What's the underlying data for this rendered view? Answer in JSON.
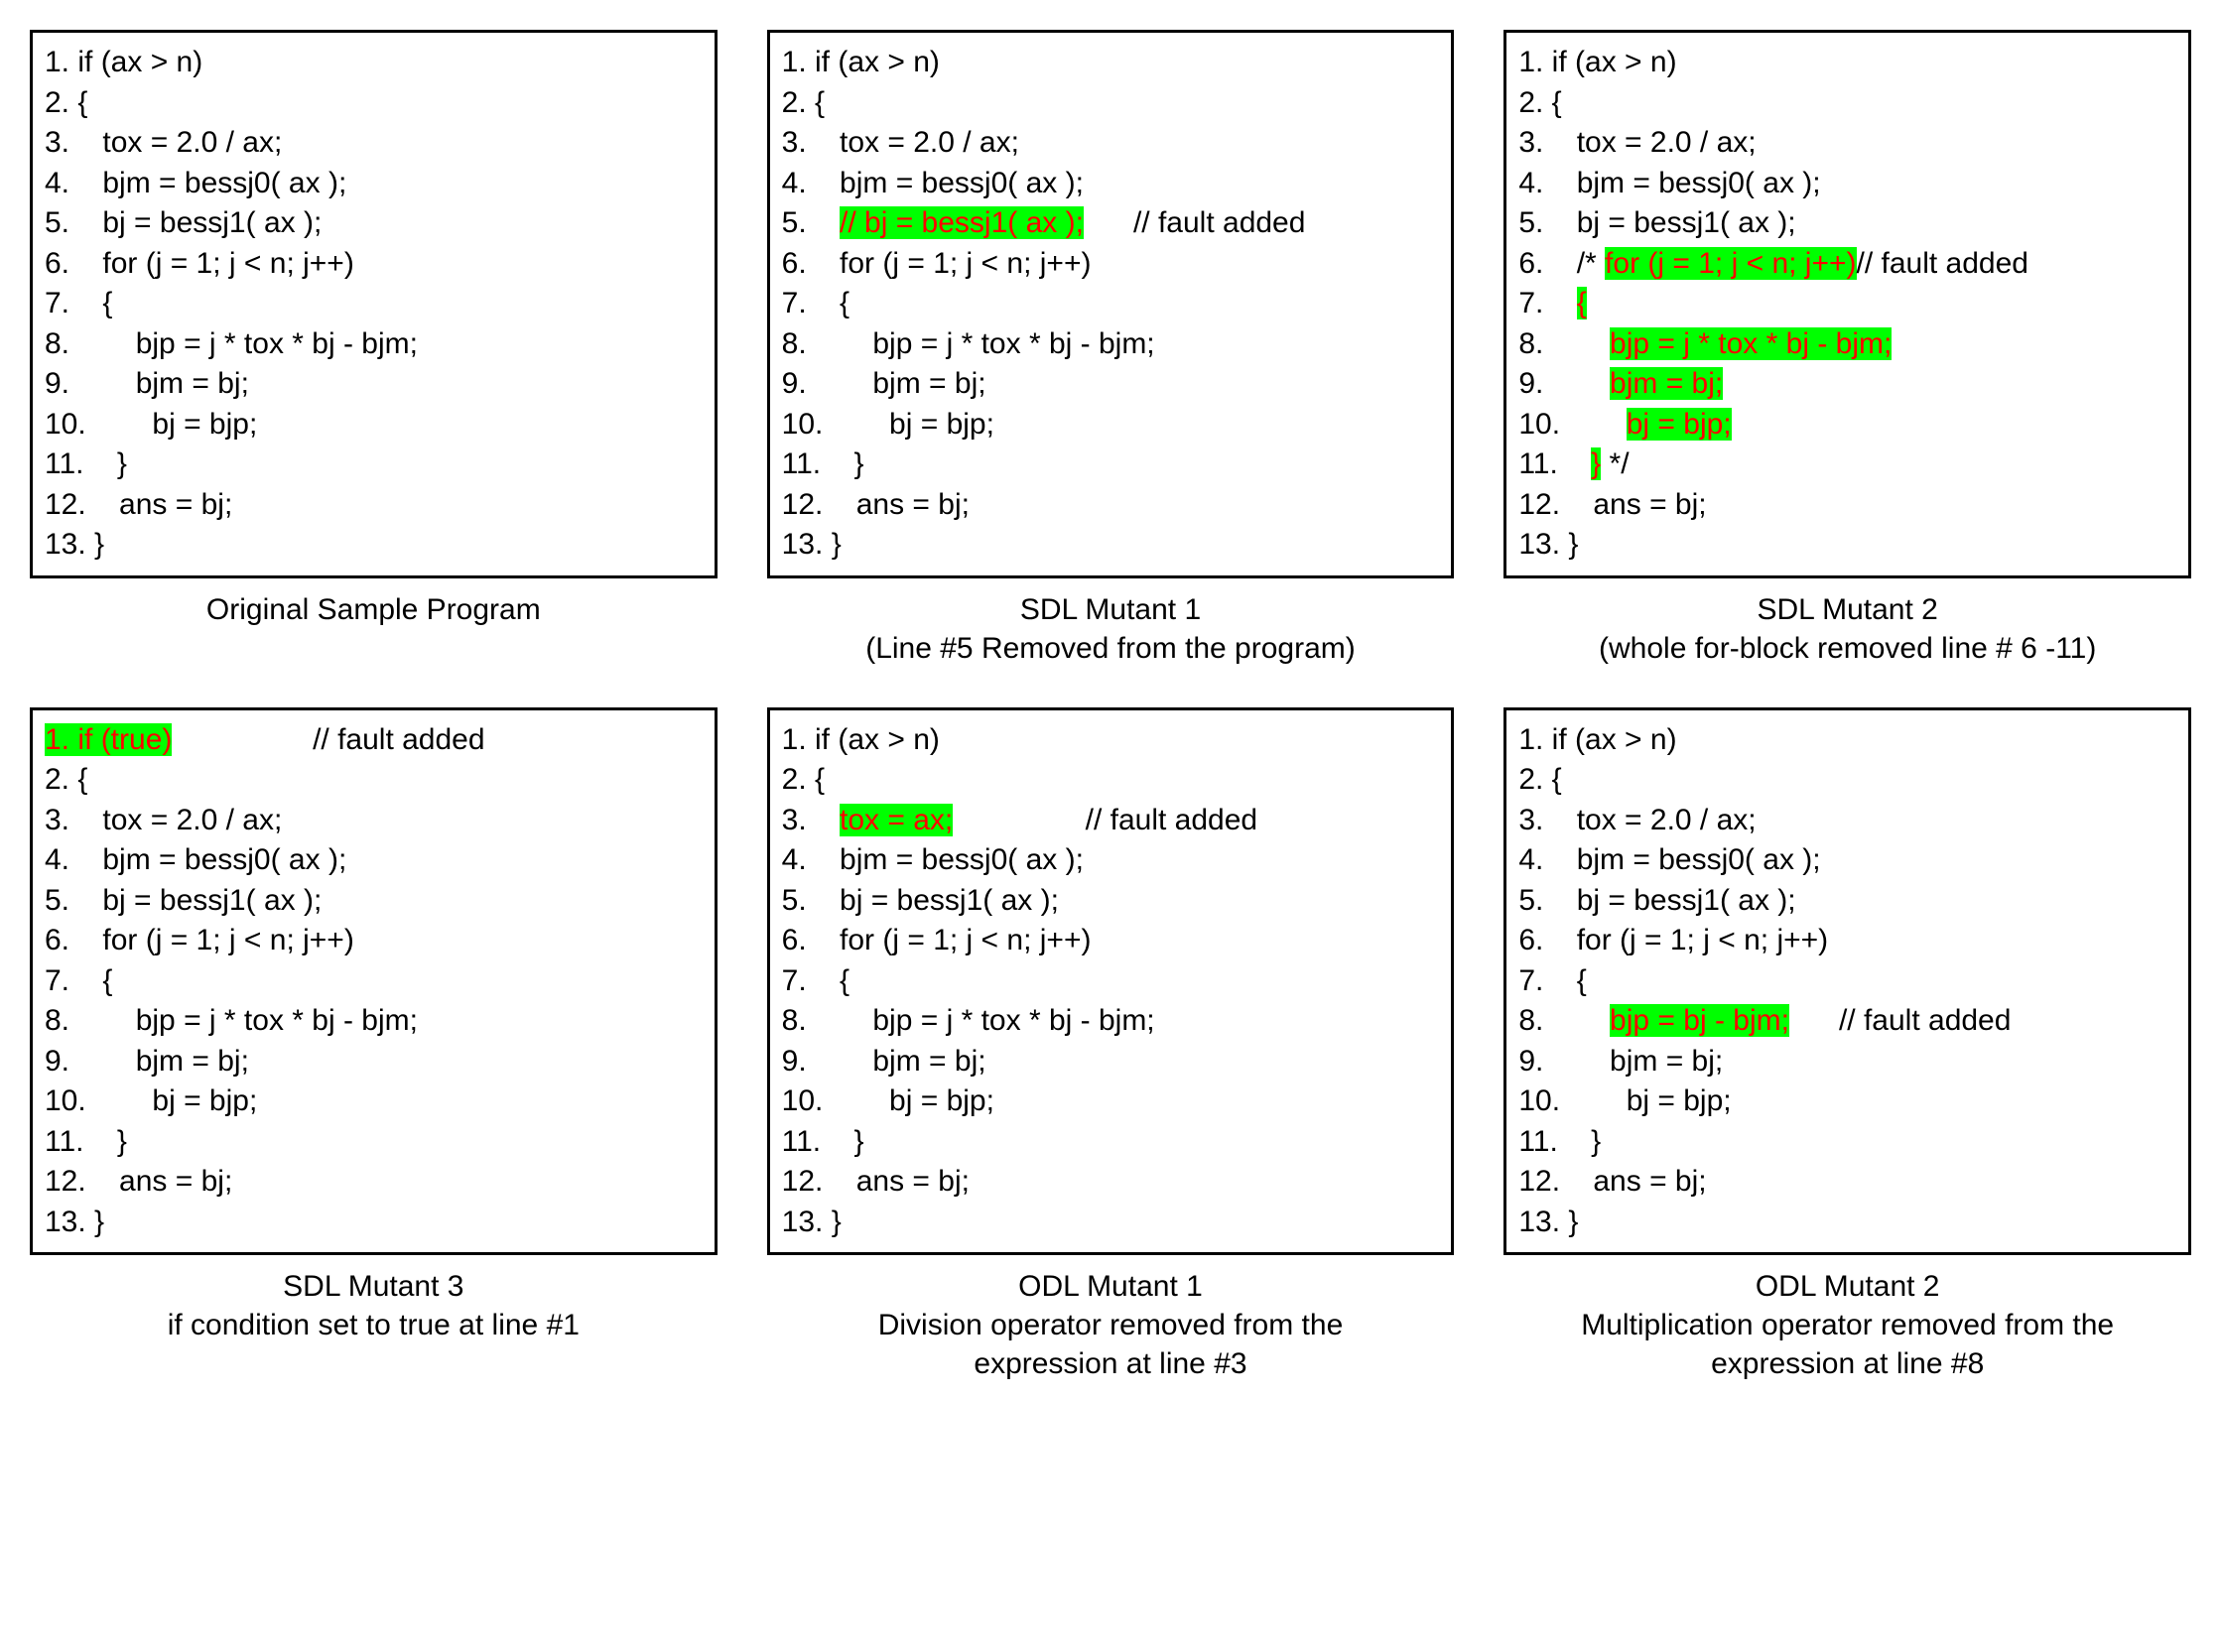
{
  "panels": [
    {
      "caption": "Original Sample Program",
      "lines": [
        {
          "segs": [
            {
              "t": "1. if (ax > n)"
            }
          ]
        },
        {
          "segs": [
            {
              "t": "2. {"
            }
          ]
        },
        {
          "segs": [
            {
              "t": "3.    tox = 2.0 / ax;"
            }
          ]
        },
        {
          "segs": [
            {
              "t": "4.    bjm = bessj0( ax );"
            }
          ]
        },
        {
          "segs": [
            {
              "t": "5.    bj = bessj1( ax );"
            }
          ]
        },
        {
          "segs": [
            {
              "t": "6.    for (j = 1; j < n; j++)"
            }
          ]
        },
        {
          "segs": [
            {
              "t": "7.    {"
            }
          ]
        },
        {
          "segs": [
            {
              "t": "8.        bjp = j * tox * bj - bjm;"
            }
          ]
        },
        {
          "segs": [
            {
              "t": "9.        bjm = bj;"
            }
          ]
        },
        {
          "segs": [
            {
              "t": "10.        bj = bjp;"
            }
          ]
        },
        {
          "segs": [
            {
              "t": "11.    }"
            }
          ]
        },
        {
          "segs": [
            {
              "t": "12.    ans = bj;"
            }
          ]
        },
        {
          "segs": [
            {
              "t": "13. }"
            }
          ]
        }
      ]
    },
    {
      "caption": "SDL Mutant 1\n(Line #5 Removed from the program)",
      "lines": [
        {
          "segs": [
            {
              "t": "1. if (ax > n)"
            }
          ]
        },
        {
          "segs": [
            {
              "t": "2. {"
            }
          ]
        },
        {
          "segs": [
            {
              "t": "3.    tox = 2.0 / ax;"
            }
          ]
        },
        {
          "segs": [
            {
              "t": "4.    bjm = bessj0( ax );"
            }
          ]
        },
        {
          "segs": [
            {
              "t": "5.    "
            },
            {
              "t": "// bj = bessj1( ax );",
              "hl": true
            },
            {
              "t": "      // fault added"
            }
          ]
        },
        {
          "segs": [
            {
              "t": "6.    for (j = 1; j < n; j++)"
            }
          ]
        },
        {
          "segs": [
            {
              "t": "7.    {"
            }
          ]
        },
        {
          "segs": [
            {
              "t": "8.        bjp = j * tox * bj - bjm;"
            }
          ]
        },
        {
          "segs": [
            {
              "t": "9.        bjm = bj;"
            }
          ]
        },
        {
          "segs": [
            {
              "t": "10.        bj = bjp;"
            }
          ]
        },
        {
          "segs": [
            {
              "t": "11.    }"
            }
          ]
        },
        {
          "segs": [
            {
              "t": "12.    ans = bj;"
            }
          ]
        },
        {
          "segs": [
            {
              "t": "13. }"
            }
          ]
        }
      ]
    },
    {
      "caption": "SDL Mutant 2\n(whole for-block removed line # 6 -11)",
      "lines": [
        {
          "segs": [
            {
              "t": "1. if (ax > n)"
            }
          ]
        },
        {
          "segs": [
            {
              "t": "2. {"
            }
          ]
        },
        {
          "segs": [
            {
              "t": "3.    tox = 2.0 / ax;"
            }
          ]
        },
        {
          "segs": [
            {
              "t": "4.    bjm = bessj0( ax );"
            }
          ]
        },
        {
          "segs": [
            {
              "t": "5.    bj = bessj1( ax );"
            }
          ]
        },
        {
          "segs": [
            {
              "t": "6.    /* "
            },
            {
              "t": "for (j = 1; j < n; j++)",
              "hl": true
            },
            {
              "t": "// fault added"
            }
          ]
        },
        {
          "segs": [
            {
              "t": "7.    "
            },
            {
              "t": "{",
              "hl": true
            }
          ]
        },
        {
          "segs": [
            {
              "t": "8.        "
            },
            {
              "t": "bjp = j * tox * bj - bjm;",
              "hl": true
            }
          ]
        },
        {
          "segs": [
            {
              "t": "9.        "
            },
            {
              "t": "bjm = bj;",
              "hl": true
            }
          ]
        },
        {
          "segs": [
            {
              "t": "10.        "
            },
            {
              "t": "bj = bjp;",
              "hl": true
            }
          ]
        },
        {
          "segs": [
            {
              "t": "11.    "
            },
            {
              "t": "}",
              "hl": true
            },
            {
              "t": " */"
            }
          ]
        },
        {
          "segs": [
            {
              "t": "12.    ans = bj;"
            }
          ]
        },
        {
          "segs": [
            {
              "t": "13. }"
            }
          ]
        }
      ]
    },
    {
      "caption": "SDL Mutant 3\nif condition set to true at line #1",
      "lines": [
        {
          "segs": [
            {
              "t": "1. if (true)",
              "hl": true
            },
            {
              "t": "                 // fault added"
            }
          ]
        },
        {
          "segs": [
            {
              "t": "2. {"
            }
          ]
        },
        {
          "segs": [
            {
              "t": "3.    tox = 2.0 / ax;"
            }
          ]
        },
        {
          "segs": [
            {
              "t": "4.    bjm = bessj0( ax );"
            }
          ]
        },
        {
          "segs": [
            {
              "t": "5.    bj = bessj1( ax );"
            }
          ]
        },
        {
          "segs": [
            {
              "t": "6.    for (j = 1; j < n; j++)"
            }
          ]
        },
        {
          "segs": [
            {
              "t": "7.    {"
            }
          ]
        },
        {
          "segs": [
            {
              "t": "8.        bjp = j * tox * bj - bjm;"
            }
          ]
        },
        {
          "segs": [
            {
              "t": "9.        bjm = bj;"
            }
          ]
        },
        {
          "segs": [
            {
              "t": "10.        bj = bjp;"
            }
          ]
        },
        {
          "segs": [
            {
              "t": "11.    }"
            }
          ]
        },
        {
          "segs": [
            {
              "t": "12.    ans = bj;"
            }
          ]
        },
        {
          "segs": [
            {
              "t": "13. }"
            }
          ]
        }
      ]
    },
    {
      "caption": "ODL Mutant 1\nDivision operator removed from the\nexpression at line #3",
      "lines": [
        {
          "segs": [
            {
              "t": "1. if (ax > n)"
            }
          ]
        },
        {
          "segs": [
            {
              "t": "2. {"
            }
          ]
        },
        {
          "segs": [
            {
              "t": "3.    "
            },
            {
              "t": "tox = ax;",
              "hl": true
            },
            {
              "t": "                // fault added"
            }
          ]
        },
        {
          "segs": [
            {
              "t": "4.    bjm = bessj0( ax );"
            }
          ]
        },
        {
          "segs": [
            {
              "t": "5.    bj = bessj1( ax );"
            }
          ]
        },
        {
          "segs": [
            {
              "t": "6.    for (j = 1; j < n; j++)"
            }
          ]
        },
        {
          "segs": [
            {
              "t": "7.    {"
            }
          ]
        },
        {
          "segs": [
            {
              "t": "8.        bjp = j * tox * bj - bjm;"
            }
          ]
        },
        {
          "segs": [
            {
              "t": "9.        bjm = bj;"
            }
          ]
        },
        {
          "segs": [
            {
              "t": "10.        bj = bjp;"
            }
          ]
        },
        {
          "segs": [
            {
              "t": "11.    }"
            }
          ]
        },
        {
          "segs": [
            {
              "t": "12.    ans = bj;"
            }
          ]
        },
        {
          "segs": [
            {
              "t": "13. }"
            }
          ]
        }
      ]
    },
    {
      "caption": "ODL Mutant 2\nMultiplication operator removed from the\nexpression at line #8",
      "lines": [
        {
          "segs": [
            {
              "t": "1. if (ax > n)"
            }
          ]
        },
        {
          "segs": [
            {
              "t": "2. {"
            }
          ]
        },
        {
          "segs": [
            {
              "t": "3.    tox = 2.0 / ax;"
            }
          ]
        },
        {
          "segs": [
            {
              "t": "4.    bjm = bessj0( ax );"
            }
          ]
        },
        {
          "segs": [
            {
              "t": "5.    bj = bessj1( ax );"
            }
          ]
        },
        {
          "segs": [
            {
              "t": "6.    for (j = 1; j < n; j++)"
            }
          ]
        },
        {
          "segs": [
            {
              "t": "7.    {"
            }
          ]
        },
        {
          "segs": [
            {
              "t": "8.        "
            },
            {
              "t": "bjp = bj - bjm;",
              "hl": true
            },
            {
              "t": "      // fault added"
            }
          ]
        },
        {
          "segs": [
            {
              "t": "9.        bjm = bj;"
            }
          ]
        },
        {
          "segs": [
            {
              "t": "10.        bj = bjp;"
            }
          ]
        },
        {
          "segs": [
            {
              "t": "11.    }"
            }
          ]
        },
        {
          "segs": [
            {
              "t": "12.    ans = bj;"
            }
          ]
        },
        {
          "segs": [
            {
              "t": "13. }"
            }
          ]
        }
      ]
    }
  ]
}
